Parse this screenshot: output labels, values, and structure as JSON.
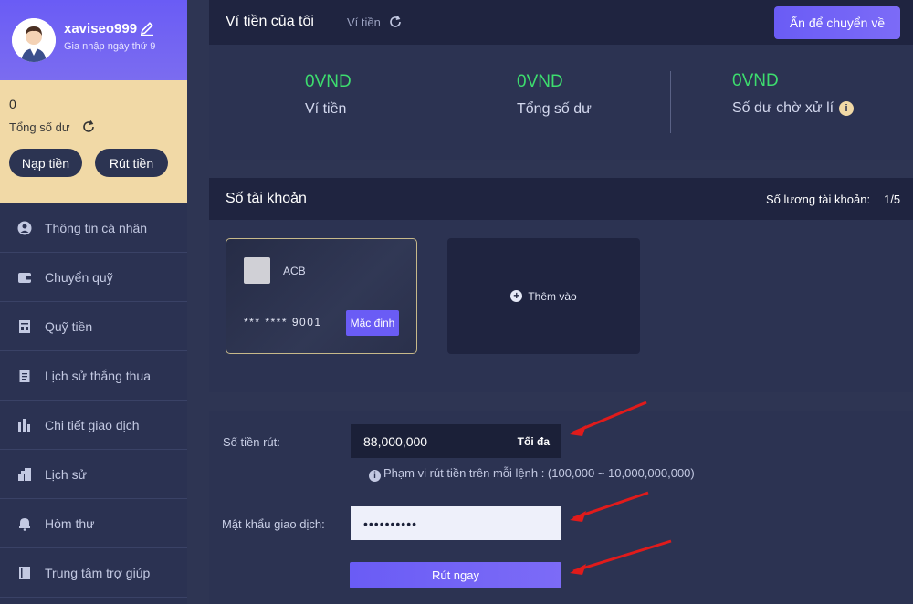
{
  "profile": {
    "username": "xaviseo999",
    "joined": "Gia nhập ngày thứ 9"
  },
  "balance": {
    "amount": "0",
    "label": "Tổng số dư",
    "deposit_label": "Nạp tiền",
    "withdraw_label": "Rút tiền"
  },
  "sidebar": {
    "items": [
      {
        "label": "Thông tin cá nhân",
        "icon": "user-icon"
      },
      {
        "label": "Chuyển quỹ",
        "icon": "wallet-icon"
      },
      {
        "label": "Quỹ tiền",
        "icon": "fund-icon"
      },
      {
        "label": "Lịch sử thắng thua",
        "icon": "clipboard-icon"
      },
      {
        "label": "Chi tiết giao dịch",
        "icon": "chart-icon"
      },
      {
        "label": "Lịch sử",
        "icon": "history-icon"
      },
      {
        "label": "Hòm thư",
        "icon": "mail-icon"
      },
      {
        "label": "Trung tâm trợ giúp",
        "icon": "book-icon"
      }
    ]
  },
  "wallet": {
    "title": "Ví tiền của tôi",
    "subtitle": "Ví tiền",
    "hide_button": "Ẩn để chuyển về",
    "stats": [
      {
        "value": "0VND",
        "label": "Ví tiền"
      },
      {
        "value": "0VND",
        "label": "Tổng số dư"
      },
      {
        "value": "0VND",
        "label": "Số dư chờ xử lí"
      }
    ]
  },
  "accounts": {
    "title": "Số tài khoản",
    "count_label": "Số lương tài khoản:",
    "count": "1/5",
    "card": {
      "bank": "ACB",
      "number": "*** **** 9001",
      "badge": "Mặc định"
    },
    "add_label": "Thêm vào"
  },
  "withdraw_form": {
    "amount_label": "Số tiền rút:",
    "amount_value": "88,000,000",
    "max_label": "Tối đa",
    "range_note": "Phạm vi rút tiền trên mỗi lệnh : (100,000 ~ 10,000,000,000)",
    "password_label": "Mật khẩu giao dịch:",
    "password_value": "••••••••••",
    "submit_label": "Rút ngay"
  },
  "colors": {
    "accent": "#6a5cf5",
    "positive": "#3ddc6e",
    "gold": "#f1d9a6",
    "arrow": "#e01b1b"
  }
}
